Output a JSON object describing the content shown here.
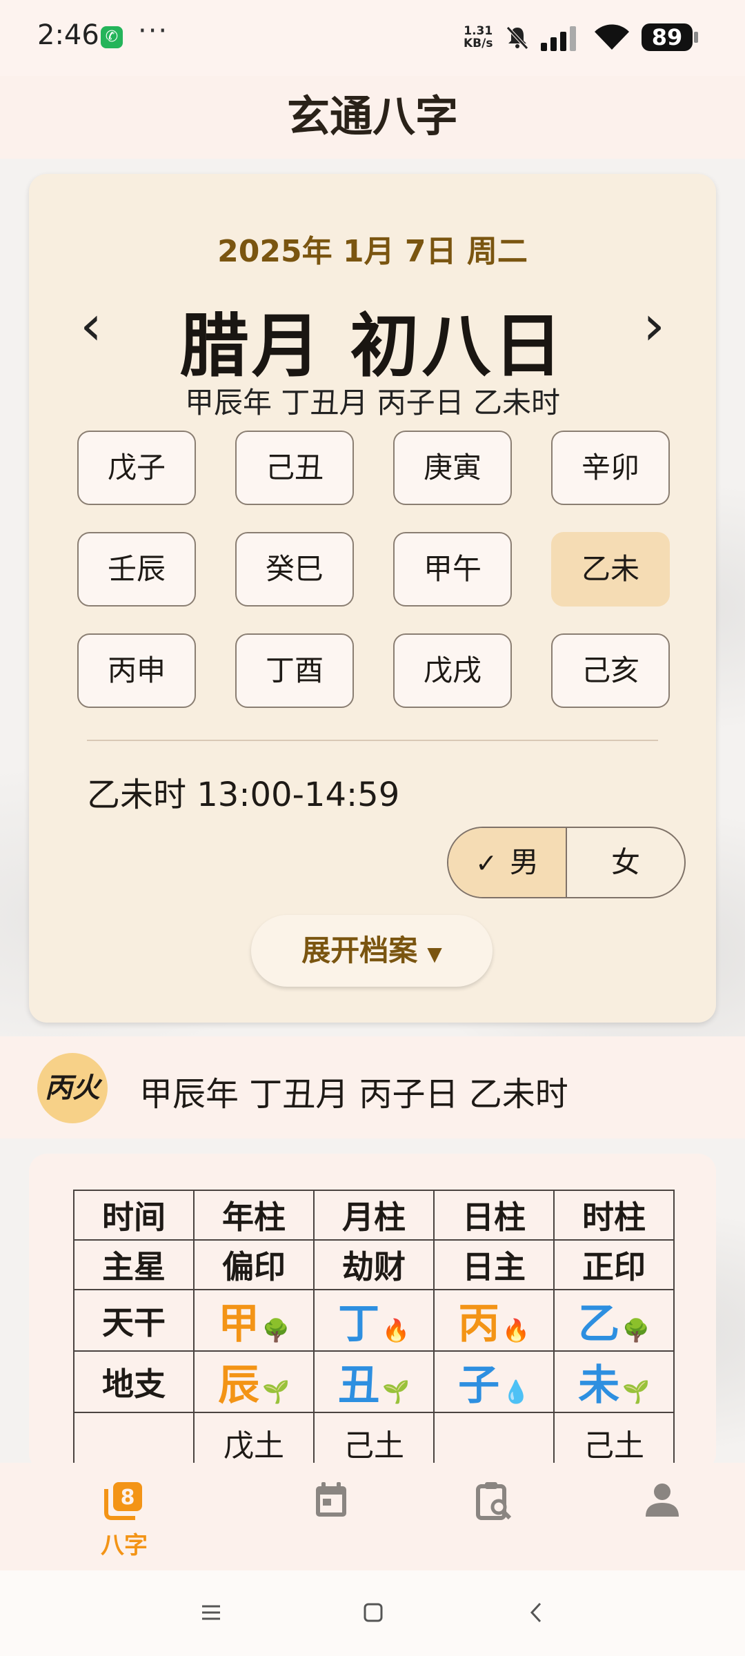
{
  "status_bar": {
    "time": "2:46",
    "net_speed_value": "1.31",
    "net_speed_unit": "KB/s",
    "battery": "89"
  },
  "app": {
    "title": "玄通八字"
  },
  "calendar": {
    "date": "2025年 1月 7日 周二",
    "lunar_date": "腊月 初八日",
    "ganzhi": "甲辰年 丁丑月 丙子日 乙未时",
    "prev_icon": "chevron-left-icon",
    "next_icon": "chevron-right-icon"
  },
  "hours": [
    "戊子",
    "己丑",
    "庚寅",
    "辛卯",
    "壬辰",
    "癸巳",
    "甲午",
    "乙未",
    "丙申",
    "丁酉",
    "戊戌",
    "己亥"
  ],
  "selected_hour": "乙未",
  "time_range": "乙未时 13:00-14:59",
  "gender": {
    "male": "男",
    "female": "女",
    "selected": "男"
  },
  "expand_button": "展开档案",
  "summary": {
    "day_master": "丙火",
    "ganzhi": "甲辰年 丁丑月 丙子日 乙未时"
  },
  "bazi_table": {
    "headers": [
      "时间",
      "年柱",
      "月柱",
      "日柱",
      "时柱"
    ],
    "main_star": {
      "label": "主星",
      "values": [
        "偏印",
        "劫财",
        "日主",
        "正印"
      ]
    },
    "tiangan": {
      "label": "天干",
      "values": [
        {
          "char": "甲",
          "element_icon": "🌳",
          "color": "#f39416"
        },
        {
          "char": "丁",
          "element_icon": "🔥",
          "color": "#2d8fe0"
        },
        {
          "char": "丙",
          "element_icon": "🔥",
          "color": "#f39416"
        },
        {
          "char": "乙",
          "element_icon": "🌳",
          "color": "#2d8fe0"
        }
      ]
    },
    "dizhi": {
      "label": "地支",
      "values": [
        {
          "char": "辰",
          "element_icon": "🌱",
          "color": "#f39416"
        },
        {
          "char": "丑",
          "element_icon": "🌱",
          "color": "#2d8fe0"
        },
        {
          "char": "子",
          "element_icon": "💧",
          "color": "#2d8fe0"
        },
        {
          "char": "未",
          "element_icon": "🌱",
          "color": "#2d8fe0"
        }
      ]
    },
    "hidden_stems": [
      "戊土",
      "己土",
      "",
      "己土"
    ]
  },
  "bottom_nav": {
    "items": [
      {
        "icon": "bazi-icon",
        "label": "八字",
        "active": true
      },
      {
        "icon": "calendar-icon",
        "label": "",
        "active": false
      },
      {
        "icon": "clipboard-search-icon",
        "label": "",
        "active": false
      },
      {
        "icon": "person-icon",
        "label": "",
        "active": false
      }
    ],
    "accent": "#f39416",
    "inactive": "#8a8581"
  }
}
